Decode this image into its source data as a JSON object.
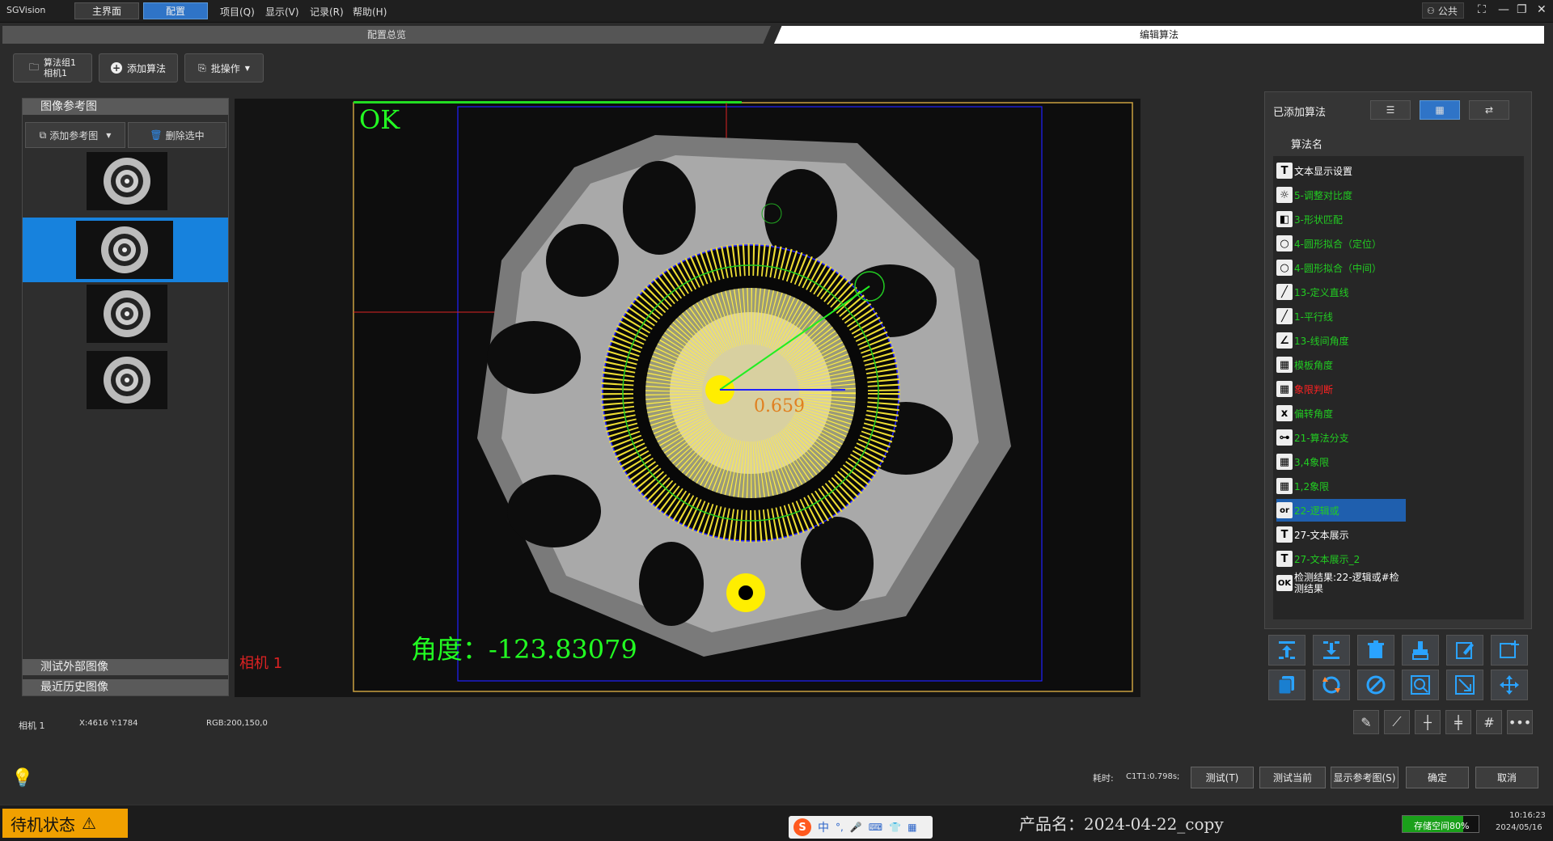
{
  "app": {
    "logo": "SGVision"
  },
  "topnav": {
    "main": "主界面",
    "config": "配置"
  },
  "menus": [
    "项目(Q)",
    "显示(V)",
    "记录(R)",
    "帮助(H)"
  ],
  "user": "公共",
  "tabs": {
    "overview": "配置总览",
    "edit": "编辑算法"
  },
  "toolbar": {
    "group_line1": "算法组1",
    "group_line2": "相机1",
    "add_algo": "添加算法",
    "batch": "批操作"
  },
  "left": {
    "header": "图像参考图",
    "add_ref": "添加参考图",
    "delete_sel": "删除选中",
    "test_external": "测试外部图像",
    "recent_history": "最近历史图像"
  },
  "viewer": {
    "ok_text": "OK",
    "angle_text": "角度：-123.83079",
    "camera_label": "相机 1",
    "overlay_value": "0.659"
  },
  "right": {
    "header": "已添加算法",
    "col_name": "算法名",
    "items": [
      {
        "icon": "T",
        "label": "文本显示设置",
        "color": "#ffffff"
      },
      {
        "icon": "☼",
        "label": "5-调整对比度",
        "color": "#22cc22"
      },
      {
        "icon": "◧",
        "label": "3-形状匹配",
        "color": "#22cc22"
      },
      {
        "icon": "○",
        "label": "4-圆形拟合（定位）",
        "color": "#22cc22"
      },
      {
        "icon": "○",
        "label": "4-圆形拟合（中间）",
        "color": "#22cc22"
      },
      {
        "icon": "╱",
        "label": "13-定义直线",
        "color": "#22cc22"
      },
      {
        "icon": "╱",
        "label": "1-平行线",
        "color": "#22cc22"
      },
      {
        "icon": "∠",
        "label": "13-线间角度",
        "color": "#22cc22"
      },
      {
        "icon": "▦",
        "label": "模板角度",
        "color": "#22cc22"
      },
      {
        "icon": "▦",
        "label": "象限判断",
        "color": "#ff2222"
      },
      {
        "icon": "x",
        "label": "偏转角度",
        "color": "#22cc22"
      },
      {
        "icon": "⊶",
        "label": "21-算法分支",
        "color": "#22cc22"
      },
      {
        "icon": "▦",
        "label": "3,4象限",
        "color": "#22cc22"
      },
      {
        "icon": "▦",
        "label": "1,2象限",
        "color": "#22cc22"
      },
      {
        "icon": "or",
        "label": "22-逻辑或",
        "color": "#22cc22"
      },
      {
        "icon": "T",
        "label": "27-文本展示",
        "color": "#ffffff"
      },
      {
        "icon": "T",
        "label": "27-文本展示_2",
        "color": "#22cc22"
      },
      {
        "icon": "OK",
        "label": "检测结果:22-逻辑或#检测结果",
        "color": "#ffffff"
      }
    ]
  },
  "coords": {
    "camera": "相机 1",
    "xy": "X:4616 Y:1784",
    "rgb": "RGB:200,150,0"
  },
  "bottom": {
    "time_label": "耗时:",
    "time_value": "C1T1:0.798s;",
    "test": "测试(T)",
    "test_current": "测试当前",
    "show_ref": "显示参考图(S)",
    "ok": "确定",
    "cancel": "取消"
  },
  "status": {
    "state": "待机状态",
    "product": "产品名：2024-04-22_copy",
    "storage": "存储空间80%",
    "storage_fraction": 0.8,
    "time": "10:16:23",
    "date": "2024/05/16",
    "ime": "中"
  },
  "colors": {
    "accent": "#2f74c7",
    "ok_green": "#22ff22",
    "status_orange": "#f0a000"
  }
}
